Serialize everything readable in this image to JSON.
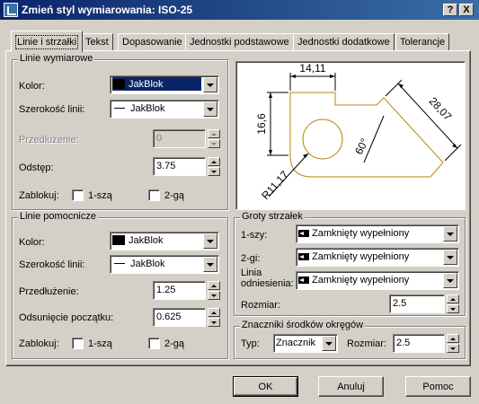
{
  "title": "Zmień styl wymiarowania: ISO-25",
  "title_buttons": {
    "help": "?",
    "close": "X"
  },
  "tabs": [
    "Linie i strzałki",
    "Tekst",
    "Dopasowanie",
    "Jednostki podstawowe",
    "Jednostki dodatkowe",
    "Tolerancje"
  ],
  "dimension_lines": {
    "title": "Linie wymiarowe",
    "color_label": "Kolor:",
    "color_value": "JakBlok",
    "lineweight_label": "Szerokość linii:",
    "lineweight_value": "JakBlok",
    "extension_label": "Przedłużenie:",
    "extension_value": "0",
    "spacing_label": "Odstęp:",
    "spacing_value": "3.75",
    "suppress_label": "Zablokuj:",
    "suppress_1": "1-szą",
    "suppress_2": "2-gą"
  },
  "extension_lines": {
    "title": "Linie pomocnicze",
    "color_label": "Kolor:",
    "color_value": "JakBlok",
    "lineweight_label": "Szerokość linii:",
    "lineweight_value": "JakBlok",
    "extension_label": "Przedłużenie:",
    "extension_value": "1.25",
    "offset_label": "Odsunięcie początku:",
    "offset_value": "0.625",
    "suppress_label": "Zablokuj:",
    "suppress_1": "1-szą",
    "suppress_2": "2-gą"
  },
  "preview": {
    "dim_top": "14,11",
    "dim_left": "16,6",
    "dim_right": "28,07",
    "dim_angle": "60°",
    "dim_radius": "R11,17"
  },
  "arrowheads": {
    "title": "Groty strzałek",
    "first_label": "1-szy:",
    "first_value": "Zamknięty wypełniony",
    "second_label": "2-gi:",
    "second_value": "Zamknięty wypełniony",
    "leader_label_1": "Linia",
    "leader_label_2": "odniesienia:",
    "leader_value": "Zamknięty wypełniony",
    "size_label": "Rozmiar:",
    "size_value": "2.5"
  },
  "center_marks": {
    "title": "Znaczniki środków okręgów",
    "type_label": "Typ:",
    "type_value": "Znacznik",
    "size_label": "Rozmiar:",
    "size_value": "2.5"
  },
  "buttons": {
    "ok": "OK",
    "cancel": "Anuluj",
    "help": "Pomoc"
  },
  "colors": {
    "titlebar": "#0a246a",
    "face": "#d4d0c8",
    "selection": "#0a246a",
    "preview_shape": "#b8860b"
  }
}
